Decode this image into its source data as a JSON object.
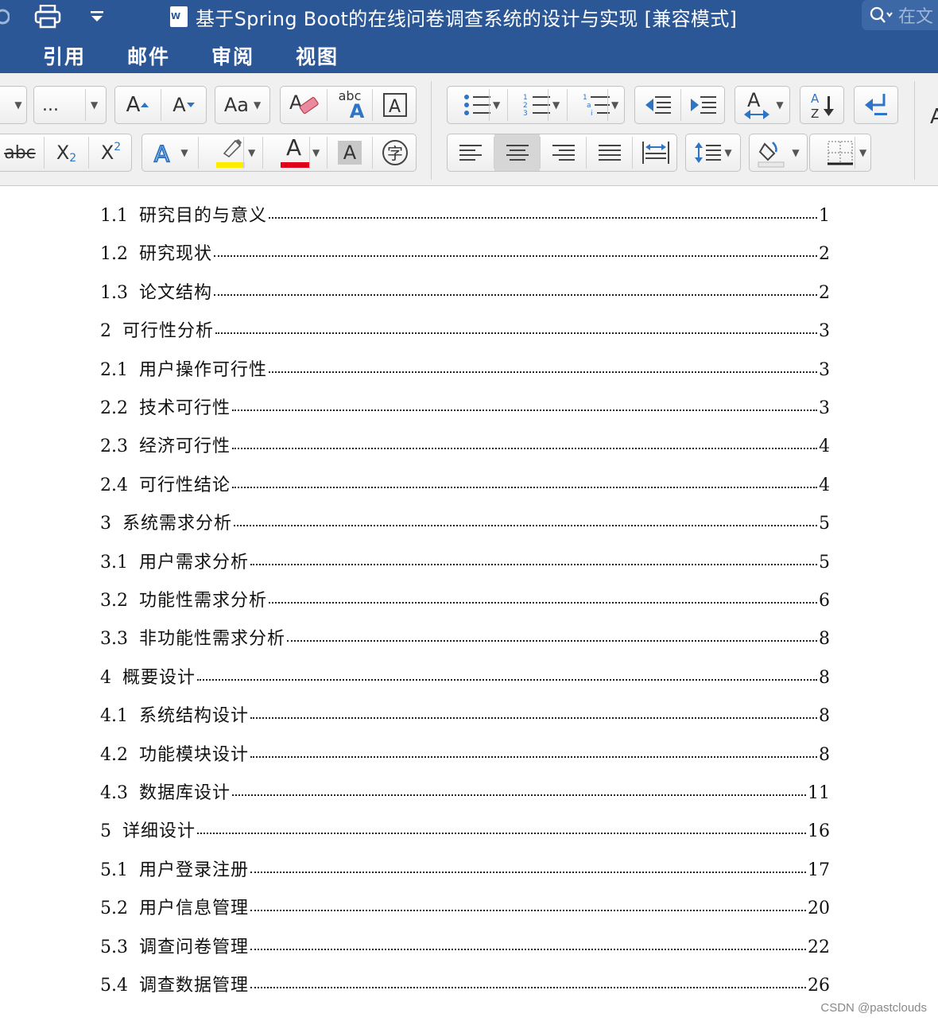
{
  "window": {
    "title": "基于Spring Boot的在线问卷调查系统的设计与实现 [兼容模式]",
    "search_placeholder": "在文"
  },
  "tabs": [
    "引用",
    "邮件",
    "审阅",
    "视图"
  ],
  "ribbon": {
    "font_size_value": "...",
    "spellcheck_label": "abc",
    "subscript_label": "X",
    "subscript_digit": "2",
    "superscript_label": "X",
    "superscript_digit": "2",
    "strikethrough_label": "abc",
    "highlight_color": "#ffeb00",
    "font_color": "#e0001b"
  },
  "toc": [
    {
      "num": "1.1",
      "title": "研究目的与意义",
      "page": "1"
    },
    {
      "num": "1.2",
      "title": "研究现状",
      "page": "2"
    },
    {
      "num": "1.3",
      "title": "论文结构",
      "page": "2"
    },
    {
      "num": "2",
      "title": "可行性分析",
      "page": "3"
    },
    {
      "num": "2.1",
      "title": "用户操作可行性",
      "page": "3"
    },
    {
      "num": "2.2",
      "title": "技术可行性",
      "page": "3"
    },
    {
      "num": "2.3",
      "title": "经济可行性",
      "page": "4"
    },
    {
      "num": "2.4",
      "title": "可行性结论",
      "page": "4"
    },
    {
      "num": "3",
      "title": "系统需求分析",
      "page": "5"
    },
    {
      "num": "3.1",
      "title": "用户需求分析",
      "page": "5"
    },
    {
      "num": "3.2",
      "title": "功能性需求分析",
      "page": "6"
    },
    {
      "num": "3.3",
      "title": "非功能性需求分析",
      "page": "8"
    },
    {
      "num": "4",
      "title": "概要设计",
      "page": "8"
    },
    {
      "num": "4.1",
      "title": "系统结构设计",
      "page": "8"
    },
    {
      "num": "4.2",
      "title": "功能模块设计",
      "page": "8"
    },
    {
      "num": "4.3",
      "title": "数据库设计",
      "page": "11"
    },
    {
      "num": "5",
      "title": "详细设计",
      "page": "16"
    },
    {
      "num": "5.1",
      "title": "用户登录注册",
      "page": "17"
    },
    {
      "num": "5.2",
      "title": "用户信息管理",
      "page": "20"
    },
    {
      "num": "5.3",
      "title": "调查问卷管理",
      "page": "22"
    },
    {
      "num": "5.4",
      "title": "调查数据管理",
      "page": "26"
    }
  ],
  "watermark": "CSDN @pastclouds"
}
